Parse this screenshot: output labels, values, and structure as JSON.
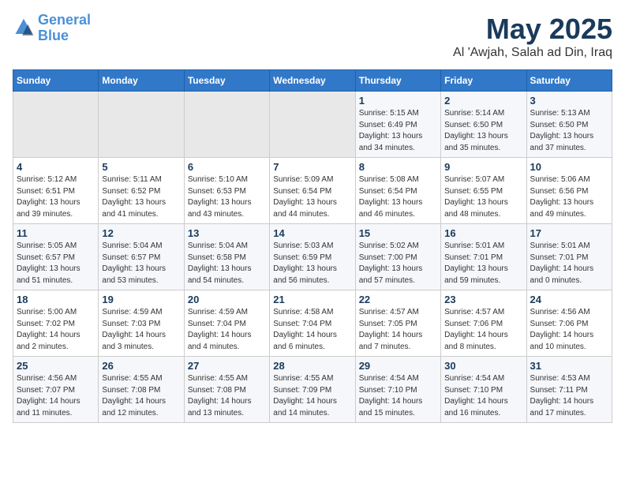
{
  "header": {
    "logo_line1": "General",
    "logo_line2": "Blue",
    "title": "May 2025",
    "subtitle": "Al 'Awjah, Salah ad Din, Iraq"
  },
  "weekdays": [
    "Sunday",
    "Monday",
    "Tuesday",
    "Wednesday",
    "Thursday",
    "Friday",
    "Saturday"
  ],
  "weeks": [
    [
      {
        "day": "",
        "sunrise": "",
        "sunset": "",
        "daylight": ""
      },
      {
        "day": "",
        "sunrise": "",
        "sunset": "",
        "daylight": ""
      },
      {
        "day": "",
        "sunrise": "",
        "sunset": "",
        "daylight": ""
      },
      {
        "day": "",
        "sunrise": "",
        "sunset": "",
        "daylight": ""
      },
      {
        "day": "1",
        "sunrise": "Sunrise: 5:15 AM",
        "sunset": "Sunset: 6:49 PM",
        "daylight": "Daylight: 13 hours and 34 minutes."
      },
      {
        "day": "2",
        "sunrise": "Sunrise: 5:14 AM",
        "sunset": "Sunset: 6:50 PM",
        "daylight": "Daylight: 13 hours and 35 minutes."
      },
      {
        "day": "3",
        "sunrise": "Sunrise: 5:13 AM",
        "sunset": "Sunset: 6:50 PM",
        "daylight": "Daylight: 13 hours and 37 minutes."
      }
    ],
    [
      {
        "day": "4",
        "sunrise": "Sunrise: 5:12 AM",
        "sunset": "Sunset: 6:51 PM",
        "daylight": "Daylight: 13 hours and 39 minutes."
      },
      {
        "day": "5",
        "sunrise": "Sunrise: 5:11 AM",
        "sunset": "Sunset: 6:52 PM",
        "daylight": "Daylight: 13 hours and 41 minutes."
      },
      {
        "day": "6",
        "sunrise": "Sunrise: 5:10 AM",
        "sunset": "Sunset: 6:53 PM",
        "daylight": "Daylight: 13 hours and 43 minutes."
      },
      {
        "day": "7",
        "sunrise": "Sunrise: 5:09 AM",
        "sunset": "Sunset: 6:54 PM",
        "daylight": "Daylight: 13 hours and 44 minutes."
      },
      {
        "day": "8",
        "sunrise": "Sunrise: 5:08 AM",
        "sunset": "Sunset: 6:54 PM",
        "daylight": "Daylight: 13 hours and 46 minutes."
      },
      {
        "day": "9",
        "sunrise": "Sunrise: 5:07 AM",
        "sunset": "Sunset: 6:55 PM",
        "daylight": "Daylight: 13 hours and 48 minutes."
      },
      {
        "day": "10",
        "sunrise": "Sunrise: 5:06 AM",
        "sunset": "Sunset: 6:56 PM",
        "daylight": "Daylight: 13 hours and 49 minutes."
      }
    ],
    [
      {
        "day": "11",
        "sunrise": "Sunrise: 5:05 AM",
        "sunset": "Sunset: 6:57 PM",
        "daylight": "Daylight: 13 hours and 51 minutes."
      },
      {
        "day": "12",
        "sunrise": "Sunrise: 5:04 AM",
        "sunset": "Sunset: 6:57 PM",
        "daylight": "Daylight: 13 hours and 53 minutes."
      },
      {
        "day": "13",
        "sunrise": "Sunrise: 5:04 AM",
        "sunset": "Sunset: 6:58 PM",
        "daylight": "Daylight: 13 hours and 54 minutes."
      },
      {
        "day": "14",
        "sunrise": "Sunrise: 5:03 AM",
        "sunset": "Sunset: 6:59 PM",
        "daylight": "Daylight: 13 hours and 56 minutes."
      },
      {
        "day": "15",
        "sunrise": "Sunrise: 5:02 AM",
        "sunset": "Sunset: 7:00 PM",
        "daylight": "Daylight: 13 hours and 57 minutes."
      },
      {
        "day": "16",
        "sunrise": "Sunrise: 5:01 AM",
        "sunset": "Sunset: 7:01 PM",
        "daylight": "Daylight: 13 hours and 59 minutes."
      },
      {
        "day": "17",
        "sunrise": "Sunrise: 5:01 AM",
        "sunset": "Sunset: 7:01 PM",
        "daylight": "Daylight: 14 hours and 0 minutes."
      }
    ],
    [
      {
        "day": "18",
        "sunrise": "Sunrise: 5:00 AM",
        "sunset": "Sunset: 7:02 PM",
        "daylight": "Daylight: 14 hours and 2 minutes."
      },
      {
        "day": "19",
        "sunrise": "Sunrise: 4:59 AM",
        "sunset": "Sunset: 7:03 PM",
        "daylight": "Daylight: 14 hours and 3 minutes."
      },
      {
        "day": "20",
        "sunrise": "Sunrise: 4:59 AM",
        "sunset": "Sunset: 7:04 PM",
        "daylight": "Daylight: 14 hours and 4 minutes."
      },
      {
        "day": "21",
        "sunrise": "Sunrise: 4:58 AM",
        "sunset": "Sunset: 7:04 PM",
        "daylight": "Daylight: 14 hours and 6 minutes."
      },
      {
        "day": "22",
        "sunrise": "Sunrise: 4:57 AM",
        "sunset": "Sunset: 7:05 PM",
        "daylight": "Daylight: 14 hours and 7 minutes."
      },
      {
        "day": "23",
        "sunrise": "Sunrise: 4:57 AM",
        "sunset": "Sunset: 7:06 PM",
        "daylight": "Daylight: 14 hours and 8 minutes."
      },
      {
        "day": "24",
        "sunrise": "Sunrise: 4:56 AM",
        "sunset": "Sunset: 7:06 PM",
        "daylight": "Daylight: 14 hours and 10 minutes."
      }
    ],
    [
      {
        "day": "25",
        "sunrise": "Sunrise: 4:56 AM",
        "sunset": "Sunset: 7:07 PM",
        "daylight": "Daylight: 14 hours and 11 minutes."
      },
      {
        "day": "26",
        "sunrise": "Sunrise: 4:55 AM",
        "sunset": "Sunset: 7:08 PM",
        "daylight": "Daylight: 14 hours and 12 minutes."
      },
      {
        "day": "27",
        "sunrise": "Sunrise: 4:55 AM",
        "sunset": "Sunset: 7:08 PM",
        "daylight": "Daylight: 14 hours and 13 minutes."
      },
      {
        "day": "28",
        "sunrise": "Sunrise: 4:55 AM",
        "sunset": "Sunset: 7:09 PM",
        "daylight": "Daylight: 14 hours and 14 minutes."
      },
      {
        "day": "29",
        "sunrise": "Sunrise: 4:54 AM",
        "sunset": "Sunset: 7:10 PM",
        "daylight": "Daylight: 14 hours and 15 minutes."
      },
      {
        "day": "30",
        "sunrise": "Sunrise: 4:54 AM",
        "sunset": "Sunset: 7:10 PM",
        "daylight": "Daylight: 14 hours and 16 minutes."
      },
      {
        "day": "31",
        "sunrise": "Sunrise: 4:53 AM",
        "sunset": "Sunset: 7:11 PM",
        "daylight": "Daylight: 14 hours and 17 minutes."
      }
    ]
  ]
}
